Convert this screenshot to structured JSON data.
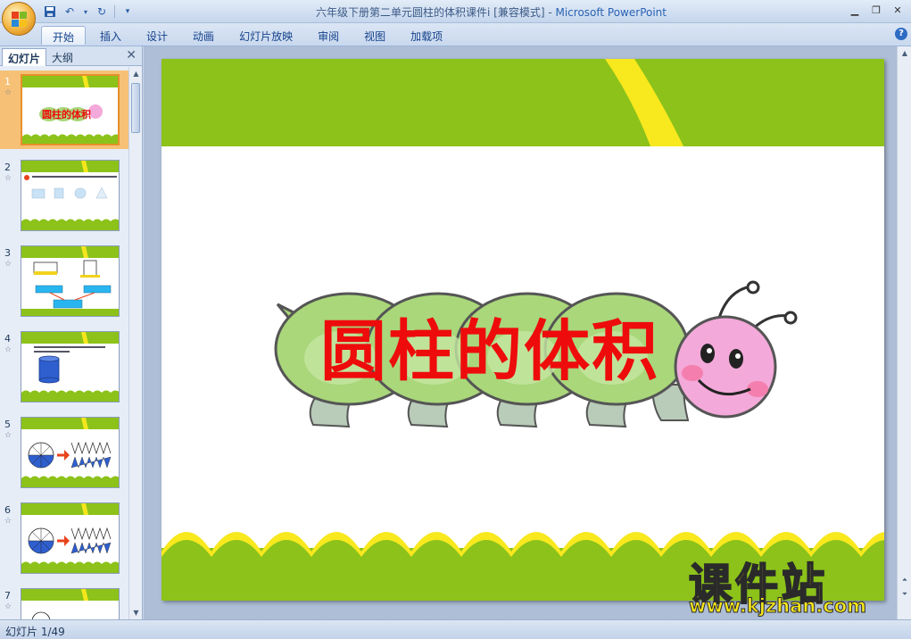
{
  "window": {
    "title": "六年级下册第二单元圆柱的体积课件i [兼容模式]",
    "title_sep": " - ",
    "app_name": "Microsoft PowerPoint"
  },
  "ribbon": {
    "tabs": [
      "开始",
      "插入",
      "设计",
      "动画",
      "幻灯片放映",
      "审阅",
      "视图",
      "加载项"
    ],
    "active_tab": "开始"
  },
  "panel": {
    "tab_slides": "幻灯片",
    "tab_outline": "大纲",
    "thumbnails": [
      {
        "num": "1"
      },
      {
        "num": "2"
      },
      {
        "num": "3"
      },
      {
        "num": "4"
      },
      {
        "num": "5"
      },
      {
        "num": "6"
      },
      {
        "num": "7"
      }
    ],
    "thumb_labels": {
      "t1_title": "圆柱的体积"
    }
  },
  "slide": {
    "title": "圆柱的体积"
  },
  "watermark": {
    "text_cn": "课件站",
    "url": "www.kjzhan.com"
  },
  "status": {
    "slide_counter": "幻灯片 1/49"
  },
  "colors": {
    "slide_green": "#8cc21a",
    "wave_yellow": "#f5e61c",
    "title_red": "#ee0b0b",
    "caterpillar_body": "#a9d77a",
    "caterpillar_head": "#f3a9d9",
    "selected_thumb": "#f6c176"
  }
}
